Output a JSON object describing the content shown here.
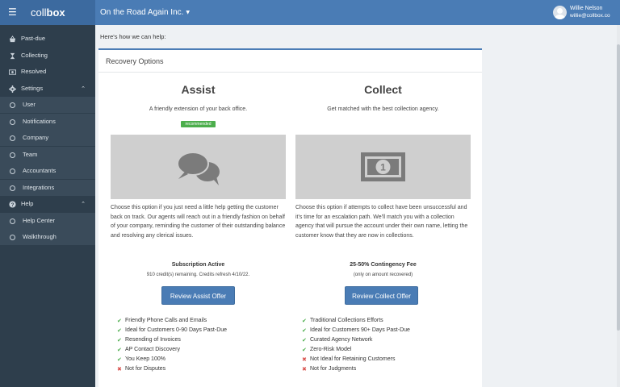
{
  "header": {
    "brand_light": "coll",
    "brand_bold": "box",
    "company": "On the Road Again Inc.",
    "user_name": "Willie Nelson",
    "user_email": "willie@collbox.co"
  },
  "sidebar": {
    "items": [
      {
        "label": "Past-due"
      },
      {
        "label": "Collecting"
      },
      {
        "label": "Resolved"
      },
      {
        "label": "Settings"
      },
      {
        "label": "User"
      },
      {
        "label": "Notifications"
      },
      {
        "label": "Company"
      },
      {
        "label": "Team"
      },
      {
        "label": "Accountants"
      },
      {
        "label": "Integrations"
      },
      {
        "label": "Help"
      },
      {
        "label": "Help Center"
      },
      {
        "label": "Walkthrough"
      }
    ]
  },
  "main": {
    "help_text": "Here's how we can help:",
    "panel_title": "Recovery Options",
    "assist": {
      "title": "Assist",
      "subtitle": "A friendly extension of your back office.",
      "badge": "recommended",
      "description": "Choose this option if you just need a little help getting the customer back on track. Our agents will reach out in a friendly fashion on behalf of your company, reminding the customer of their outstanding balance and resolving any clerical issues.",
      "plan": "Subscription Active",
      "plan_note": "910 credit(s) remaining. Credits refresh 4/10/22.",
      "button": "Review Assist Offer",
      "features": [
        {
          "text": "Friendly Phone Calls and Emails",
          "ok": true
        },
        {
          "text": "Ideal for Customers 0-90 Days Past-Due",
          "ok": true
        },
        {
          "text": "Resending of Invoices",
          "ok": true
        },
        {
          "text": "AP Contact Discovery",
          "ok": true
        },
        {
          "text": "You Keep 100%",
          "ok": true
        },
        {
          "text": "Not for Disputes",
          "ok": false
        }
      ]
    },
    "collect": {
      "title": "Collect",
      "subtitle": "Get matched with the best collection agency.",
      "description": "Choose this option if attempts to collect have been unsuccessful and it's time for an escalation path. We'll match you with a collection agency that will pursue the account under their own name, letting the customer know that they are now in collections.",
      "plan": "25-50% Contingency Fee",
      "plan_note": "(only on amount recovered)",
      "button": "Review Collect Offer",
      "features": [
        {
          "text": "Traditional Collections Efforts",
          "ok": true
        },
        {
          "text": "Ideal for Customers 90+ Days Past-Due",
          "ok": true
        },
        {
          "text": "Curated Agency Network",
          "ok": true
        },
        {
          "text": "Zero-Risk Model",
          "ok": true
        },
        {
          "text": "Not Ideal for Retaining Customers",
          "ok": false
        },
        {
          "text": "Not for Judgments",
          "ok": false
        }
      ]
    }
  },
  "colors": {
    "accent": "#4a7cb5",
    "sidebar": "#2e3e4c",
    "success": "#4cae4c",
    "danger": "#d9534f"
  }
}
